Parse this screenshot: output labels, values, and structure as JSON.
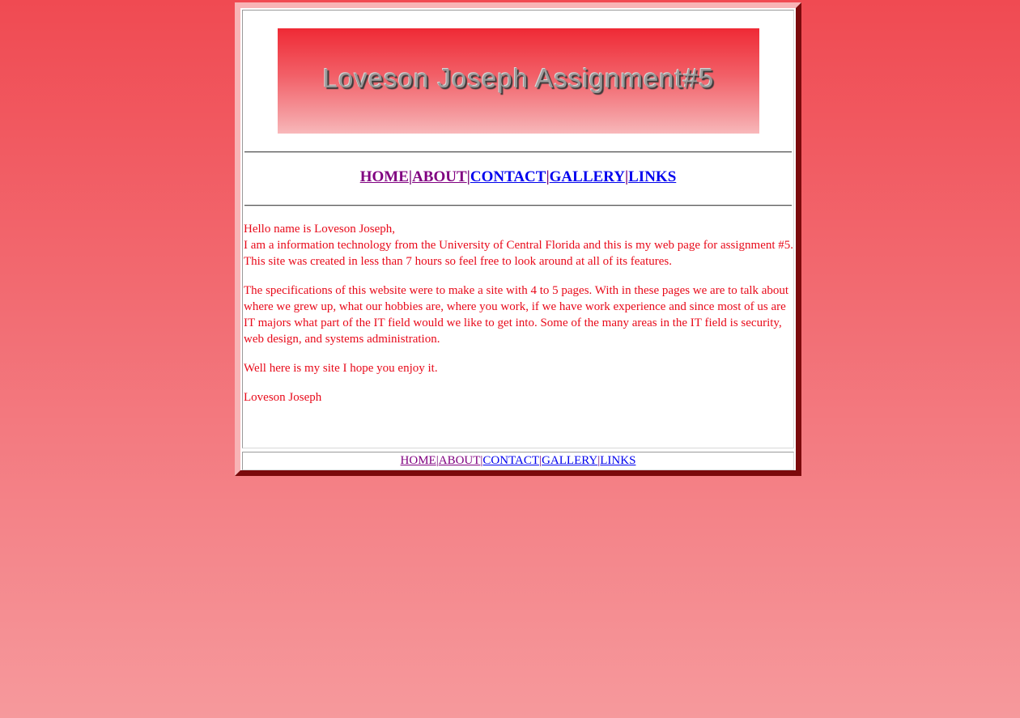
{
  "header": {
    "banner_text": "Loveson Joseph Assignment#5"
  },
  "nav_top": {
    "items": [
      {
        "label": "HOME",
        "visited": true
      },
      {
        "label": "ABOUT",
        "visited": true
      },
      {
        "label": "CONTACT",
        "visited": false
      },
      {
        "label": "GALLERY",
        "visited": false
      },
      {
        "label": "LINKS",
        "visited": false
      }
    ],
    "separator": "|"
  },
  "content": {
    "paragraph1_line1": "Hello name is Loveson Joseph,",
    "paragraph1_line2": "I am a information technology from the University of Central Florida and this is my web page for assignment #5.",
    "paragraph1_line3": "This site was created in less than 7 hours so feel free to look around at all of its features.",
    "paragraph2": "The specifications of this website were to make a site with 4 to 5 pages. With in these pages we are to talk about where we grew up, what our hobbies are, where you work, if we have work experience and since most of us are IT majors what part of the IT field would we like to get into. Some of the many areas in the IT field is security, web design, and systems administration.",
    "paragraph3": "Well here is my site I hope you enjoy it.",
    "signature": "Loveson Joseph"
  },
  "nav_bottom": {
    "items": [
      {
        "label": "HOME",
        "visited": true
      },
      {
        "label": "ABOUT",
        "visited": true
      },
      {
        "label": "CONTACT",
        "visited": false
      },
      {
        "label": "GALLERY",
        "visited": false
      },
      {
        "label": "LINKS",
        "visited": false
      }
    ],
    "separator": "|"
  },
  "colors": {
    "page_background_top": "#f04a52",
    "page_background_bottom": "#f6999c",
    "body_text": "#e80a1a",
    "visited_link": "#800080",
    "unvisited_link": "#0000ee",
    "frame_shadow": "#7c0a0c"
  }
}
